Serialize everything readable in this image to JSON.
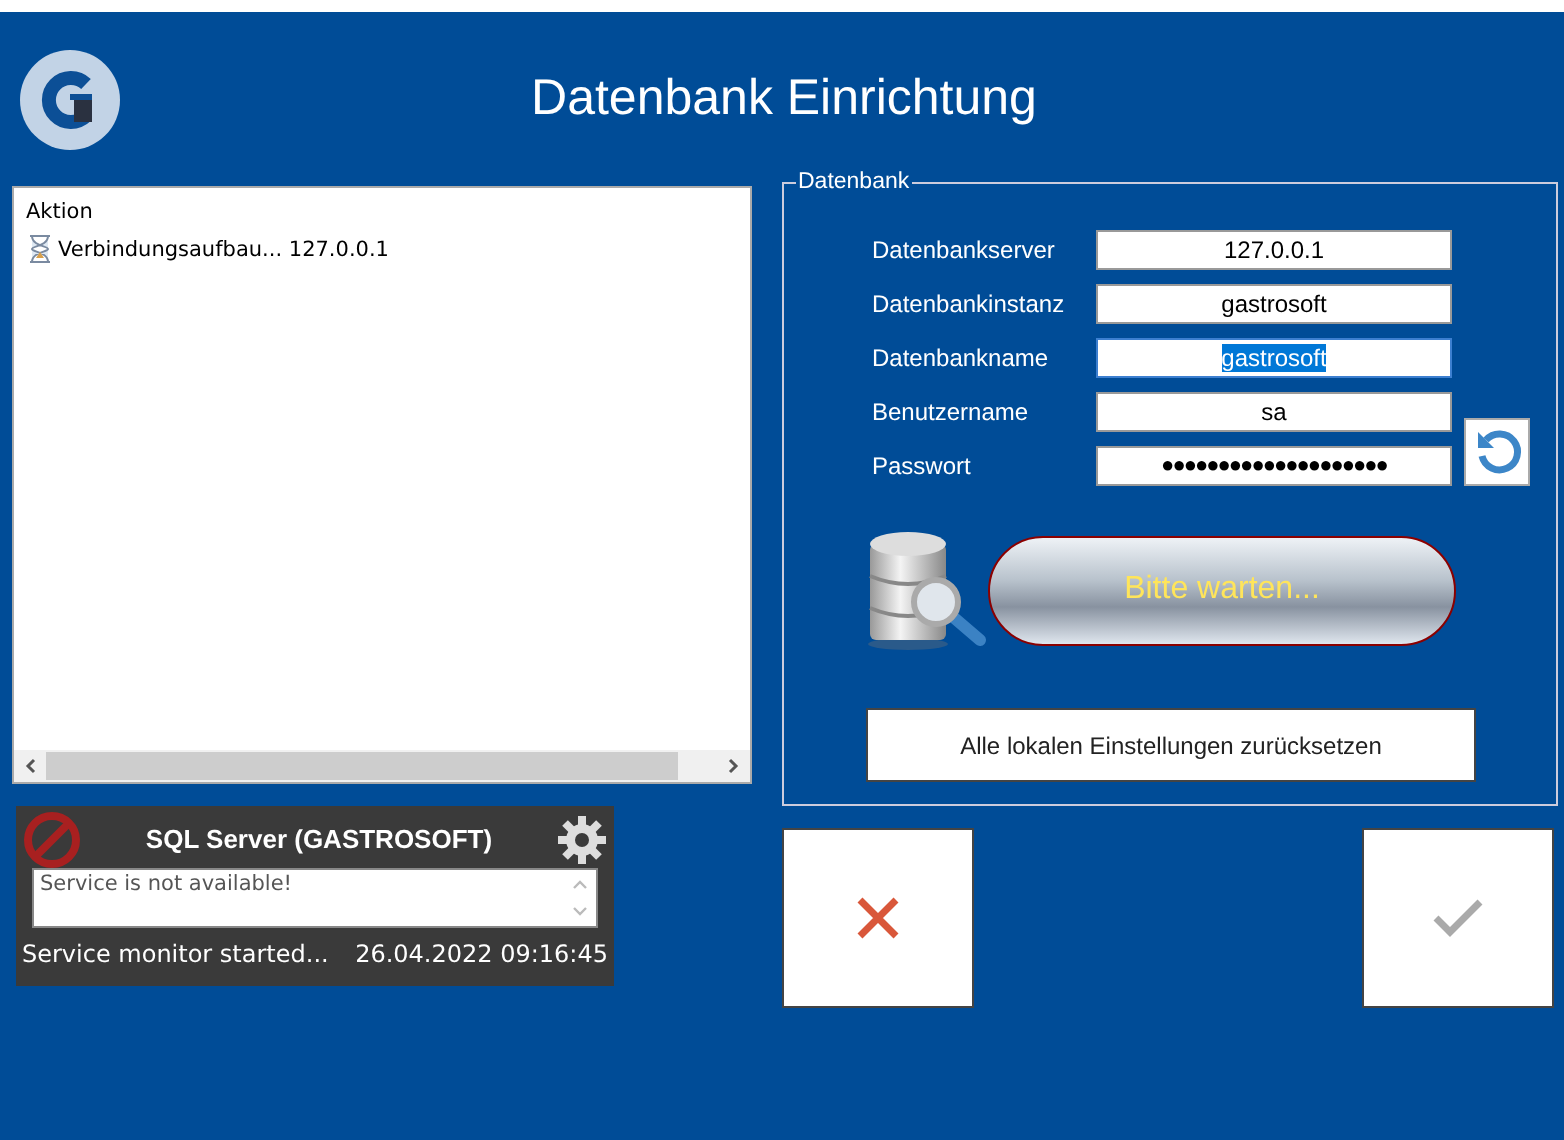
{
  "title": "Datenbank Einrichtung",
  "action_list": {
    "header": "Aktion",
    "items": [
      {
        "text": "Verbindungsaufbau... 127.0.0.1",
        "kind": "pending"
      }
    ]
  },
  "service_monitor": {
    "title": "SQL Server (GASTROSOFT)",
    "message": "Service is not available!",
    "status": "Service monitor started...",
    "timestamp": "26.04.2022 09:16:45",
    "available": false
  },
  "database": {
    "legend": "Datenbank",
    "fields": [
      {
        "label": "Datenbankserver",
        "value": "127.0.0.1",
        "kind": "text",
        "selected": false
      },
      {
        "label": "Datenbankinstanz",
        "value": "gastrosoft",
        "kind": "text",
        "selected": false
      },
      {
        "label": "Datenbankname",
        "value": "gastrosoft",
        "kind": "text",
        "selected": true
      },
      {
        "label": "Benutzername",
        "value": "sa",
        "kind": "text",
        "selected": false
      },
      {
        "label": "Passwort",
        "value": "●●●●●●●●●●●●●●●●●●●●",
        "kind": "password",
        "selected": false
      }
    ],
    "connect_button": "Bitte warten...",
    "reset_button": "Alle lokalen Einstellungen zurücksetzen"
  }
}
